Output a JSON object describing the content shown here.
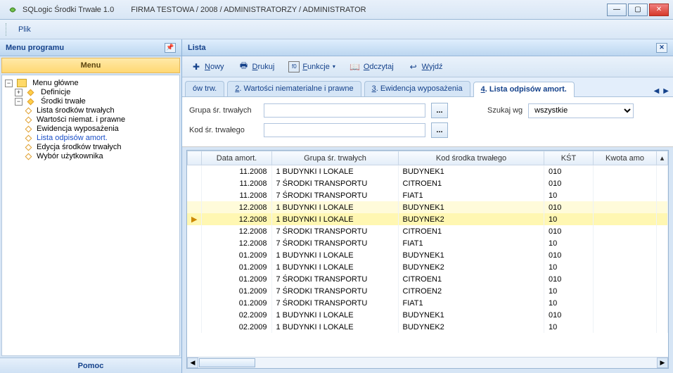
{
  "title": {
    "app": "SQLogic Środki Trwałe 1.0",
    "context": "FIRMA TESTOWA / 2008 / ADMINISTRATORZY /  ADMINISTRATOR"
  },
  "menubar": {
    "plik": "Plik"
  },
  "left": {
    "header": "Menu programu",
    "subheader": "Menu",
    "tree": {
      "root": "Menu główne",
      "n1": "Definicje",
      "n2": "Środki trwałe",
      "n2_1": "Lista środków trwałych",
      "n2_2": "Wartości niemat. i prawne",
      "n2_3": "Ewidencja wyposażenia",
      "n2_4": "Lista odpisów amort.",
      "n2_5": "Edycja środków trwałych",
      "n2_6": "Wybór użytkownika"
    },
    "bottom": "Pomoc"
  },
  "right": {
    "header": "Lista",
    "toolbar": {
      "nowy": "Nowy",
      "drukuj": "Drukuj",
      "funkcje": "Funkcje",
      "odczytaj": "Odczytaj",
      "wyjdz": "Wyjdź"
    },
    "tabs": {
      "t1_frag": "ów trw.",
      "t2": "2. Wartości niematerialne i prawne",
      "t3": "3. Ewidencja wyposażenia",
      "t4": "4. Lista odpisów amort."
    },
    "filters": {
      "grupa_label": "Grupa śr. trwałych",
      "kod_label": "Kod śr. trwałego",
      "szukaj_label": "Szukaj wg",
      "szukaj_value": "wszystkie"
    },
    "grid": {
      "headers": {
        "data": "Data amort.",
        "grupa": "Grupa śr. trwałych",
        "kod": "Kod środka trwałego",
        "kst": "KŚT",
        "kwota": "Kwota amo"
      },
      "rows": [
        {
          "d": "11.2008",
          "g": "1 BUDYNKI I LOKALE",
          "k": "BUDYNEK1",
          "s": "010",
          "kw": ""
        },
        {
          "d": "11.2008",
          "g": "7 ŚRODKI TRANSPORTU",
          "k": "CITROEN1",
          "s": "010",
          "kw": ""
        },
        {
          "d": "11.2008",
          "g": "7 ŚRODKI TRANSPORTU",
          "k": "FIAT1",
          "s": "10",
          "kw": ""
        },
        {
          "d": "12.2008",
          "g": "1 BUDYNKI I LOKALE",
          "k": "BUDYNEK1",
          "s": "010",
          "kw": ""
        },
        {
          "d": "12.2008",
          "g": "1 BUDYNKI I LOKALE",
          "k": "BUDYNEK2",
          "s": "10",
          "kw": "",
          "sel": true
        },
        {
          "d": "12.2008",
          "g": "7 ŚRODKI TRANSPORTU",
          "k": "CITROEN1",
          "s": "010",
          "kw": ""
        },
        {
          "d": "12.2008",
          "g": "7 ŚRODKI TRANSPORTU",
          "k": "FIAT1",
          "s": "10",
          "kw": ""
        },
        {
          "d": "01.2009",
          "g": "1 BUDYNKI I LOKALE",
          "k": "BUDYNEK1",
          "s": "010",
          "kw": ""
        },
        {
          "d": "01.2009",
          "g": "1 BUDYNKI I LOKALE",
          "k": "BUDYNEK2",
          "s": "10",
          "kw": ""
        },
        {
          "d": "01.2009",
          "g": "7 ŚRODKI TRANSPORTU",
          "k": "CITROEN1",
          "s": "010",
          "kw": ""
        },
        {
          "d": "01.2009",
          "g": "7 ŚRODKI TRANSPORTU",
          "k": "CITROEN2",
          "s": "10",
          "kw": ""
        },
        {
          "d": "01.2009",
          "g": "7 ŚRODKI TRANSPORTU",
          "k": "FIAT1",
          "s": "10",
          "kw": ""
        },
        {
          "d": "02.2009",
          "g": "1 BUDYNKI I LOKALE",
          "k": "BUDYNEK1",
          "s": "010",
          "kw": ""
        },
        {
          "d": "02.2009",
          "g": "1 BUDYNKI I LOKALE",
          "k": "BUDYNEK2",
          "s": "10",
          "kw": ""
        }
      ]
    }
  }
}
